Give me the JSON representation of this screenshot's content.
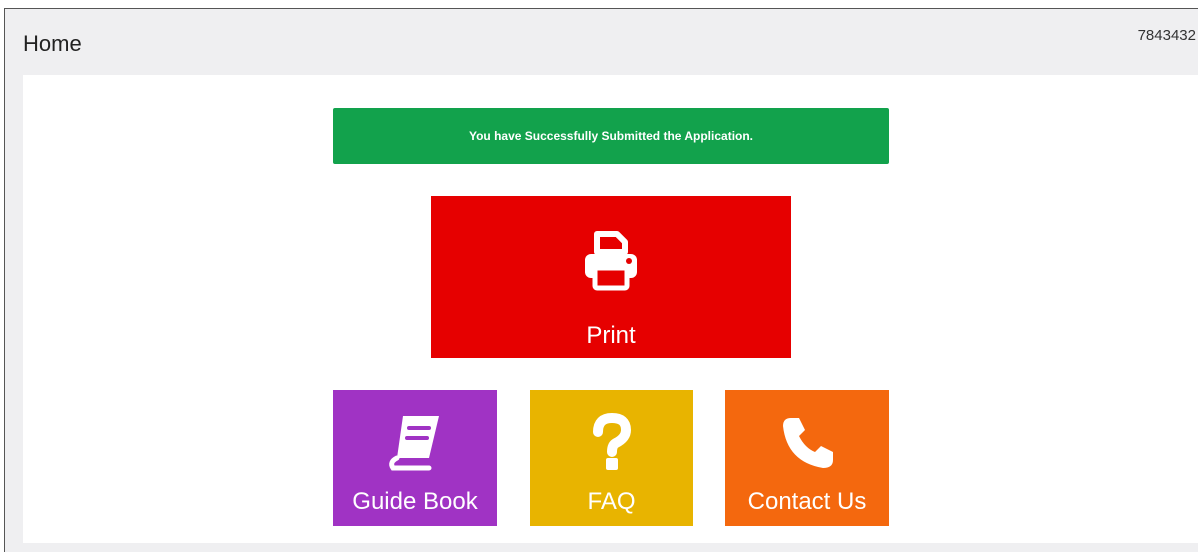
{
  "header": {
    "title": "Home",
    "user_id": "7843432"
  },
  "alert": {
    "message": "You have Successfully Submitted the Application.",
    "color": "#12a24c"
  },
  "tiles": {
    "print": {
      "label": "Print",
      "icon": "printer-icon",
      "color": "#e60000"
    },
    "guide_book": {
      "label": "Guide Book",
      "icon": "book-icon",
      "color": "#a033c4"
    },
    "faq": {
      "label": "FAQ",
      "icon": "question-mark-icon",
      "color": "#e8b400"
    },
    "contact_us": {
      "label": "Contact Us",
      "icon": "phone-icon",
      "color": "#f4680e"
    }
  }
}
